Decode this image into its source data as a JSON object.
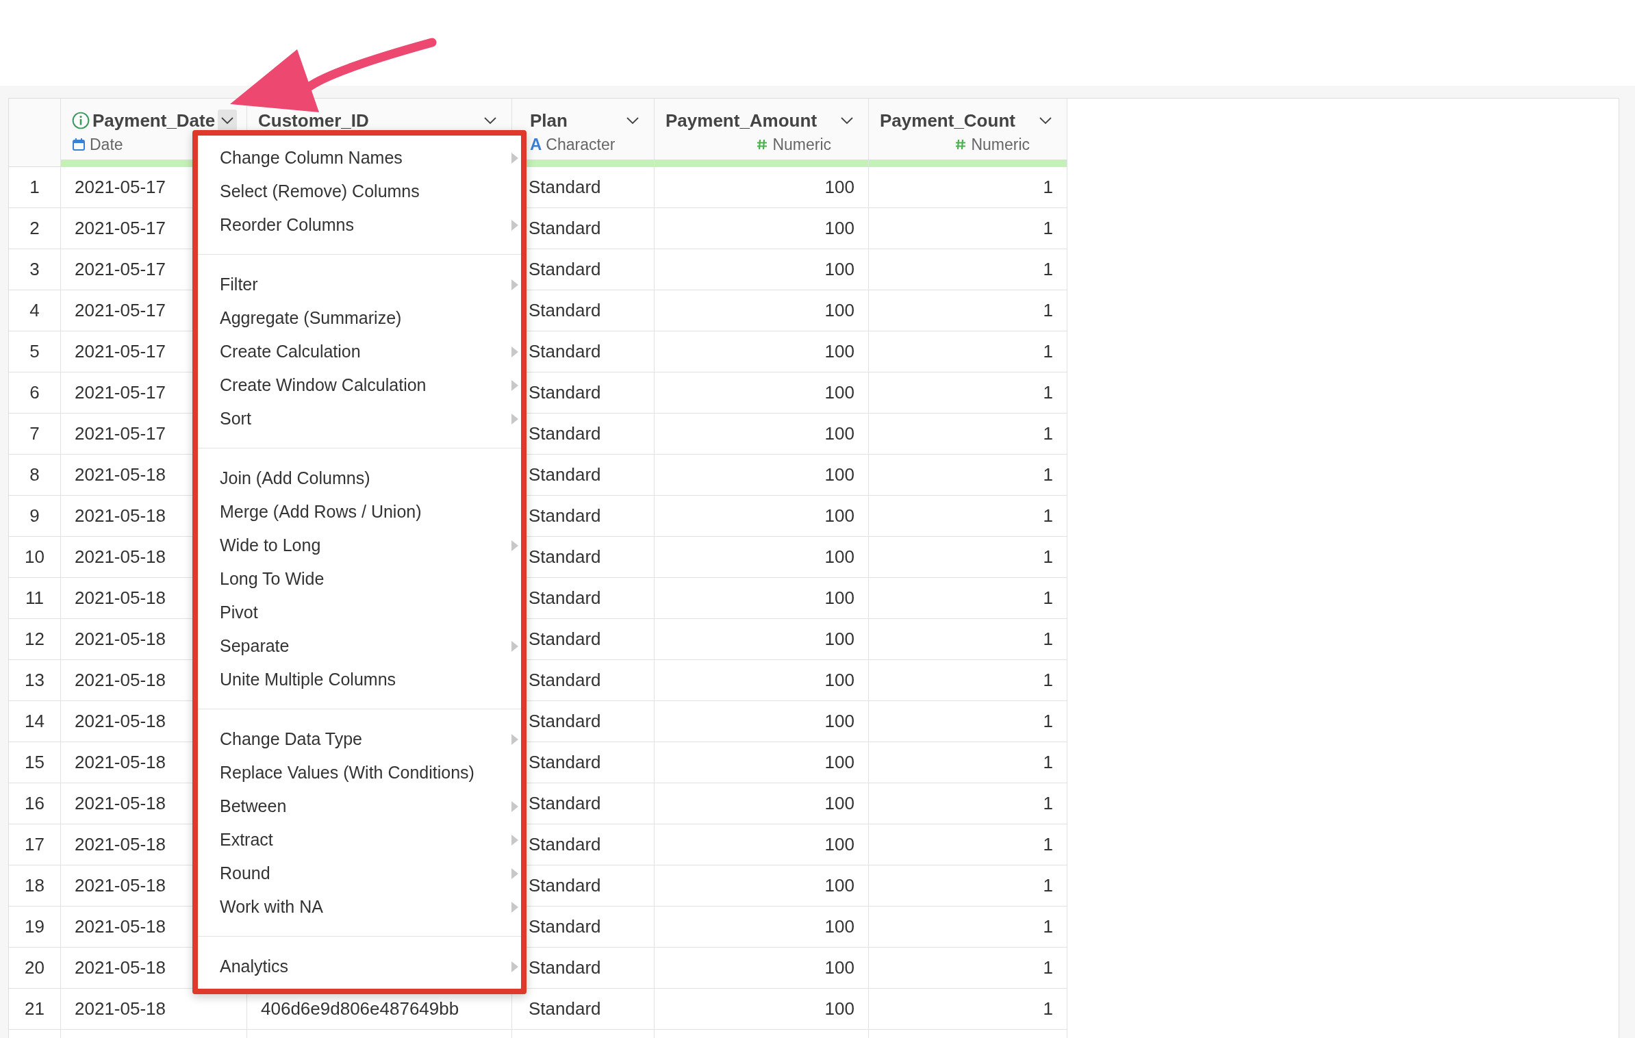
{
  "columns": [
    {
      "name": "Payment_Date",
      "type": "Date",
      "kind": "date",
      "info": true,
      "selected": true
    },
    {
      "name": "Customer_ID",
      "info": false,
      "selected": false
    },
    {
      "name": "Plan",
      "type": "Character",
      "kind": "character",
      "type_glyph": "A",
      "info": false,
      "selected": false
    },
    {
      "name": "Payment_Amount",
      "type": "Numeric",
      "kind": "numeric",
      "info": false,
      "selected": false
    },
    {
      "name": "Payment_Count",
      "type": "Numeric",
      "kind": "numeric",
      "info": false,
      "selected": false
    }
  ],
  "rows": [
    {
      "num": "1",
      "date": "2021-05-17",
      "plan": "Standard",
      "amount": "100",
      "count": "1"
    },
    {
      "num": "2",
      "date": "2021-05-17",
      "plan": "Standard",
      "amount": "100",
      "count": "1"
    },
    {
      "num": "3",
      "date": "2021-05-17",
      "plan": "Standard",
      "amount": "100",
      "count": "1"
    },
    {
      "num": "4",
      "date": "2021-05-17",
      "plan": "Standard",
      "amount": "100",
      "count": "1"
    },
    {
      "num": "5",
      "date": "2021-05-17",
      "plan": "Standard",
      "amount": "100",
      "count": "1"
    },
    {
      "num": "6",
      "date": "2021-05-17",
      "plan": "Standard",
      "amount": "100",
      "count": "1"
    },
    {
      "num": "7",
      "date": "2021-05-17",
      "plan": "Standard",
      "amount": "100",
      "count": "1"
    },
    {
      "num": "8",
      "date": "2021-05-18",
      "plan": "Standard",
      "amount": "100",
      "count": "1"
    },
    {
      "num": "9",
      "date": "2021-05-18",
      "plan": "Standard",
      "amount": "100",
      "count": "1"
    },
    {
      "num": "10",
      "date": "2021-05-18",
      "plan": "Standard",
      "amount": "100",
      "count": "1"
    },
    {
      "num": "11",
      "date": "2021-05-18",
      "plan": "Standard",
      "amount": "100",
      "count": "1"
    },
    {
      "num": "12",
      "date": "2021-05-18",
      "plan": "Standard",
      "amount": "100",
      "count": "1"
    },
    {
      "num": "13",
      "date": "2021-05-18",
      "plan": "Standard",
      "amount": "100",
      "count": "1"
    },
    {
      "num": "14",
      "date": "2021-05-18",
      "plan": "Standard",
      "amount": "100",
      "count": "1"
    },
    {
      "num": "15",
      "date": "2021-05-18",
      "plan": "Standard",
      "amount": "100",
      "count": "1"
    },
    {
      "num": "16",
      "date": "2021-05-18",
      "plan": "Standard",
      "amount": "100",
      "count": "1"
    },
    {
      "num": "17",
      "date": "2021-05-18",
      "plan": "Standard",
      "amount": "100",
      "count": "1"
    },
    {
      "num": "18",
      "date": "2021-05-18",
      "plan": "Standard",
      "amount": "100",
      "count": "1"
    },
    {
      "num": "19",
      "date": "2021-05-18",
      "plan": "Standard",
      "amount": "100",
      "count": "1"
    },
    {
      "num": "20",
      "date": "2021-05-18",
      "plan": "Standard",
      "amount": "100",
      "count": "1"
    },
    {
      "num": "21",
      "date": "2021-05-18",
      "customer_id": "406d6e9d806e487649bb",
      "plan": "Standard",
      "amount": "100",
      "count": "1"
    }
  ],
  "context_menu": {
    "groups": [
      {
        "items": [
          {
            "label": "Change Column Names",
            "submenu": true
          },
          {
            "label": "Select (Remove) Columns",
            "submenu": false
          },
          {
            "label": "Reorder Columns",
            "submenu": true
          }
        ]
      },
      {
        "items": [
          {
            "label": "Filter",
            "submenu": true
          },
          {
            "label": "Aggregate (Summarize)",
            "submenu": false
          },
          {
            "label": "Create Calculation",
            "submenu": true
          },
          {
            "label": "Create Window Calculation",
            "submenu": true
          },
          {
            "label": "Sort",
            "submenu": true
          }
        ]
      },
      {
        "items": [
          {
            "label": "Join (Add Columns)",
            "submenu": false
          },
          {
            "label": "Merge (Add Rows / Union)",
            "submenu": false
          },
          {
            "label": "Wide to Long",
            "submenu": true
          },
          {
            "label": "Long To Wide",
            "submenu": false
          },
          {
            "label": "Pivot",
            "submenu": false
          },
          {
            "label": "Separate",
            "submenu": true
          },
          {
            "label": "Unite Multiple Columns",
            "submenu": false
          }
        ]
      },
      {
        "items": [
          {
            "label": "Change Data Type",
            "submenu": true
          },
          {
            "label": "Replace Values (With Conditions)",
            "submenu": false
          },
          {
            "label": "Between",
            "submenu": true
          },
          {
            "label": "Extract",
            "submenu": true
          },
          {
            "label": "Round",
            "submenu": true
          },
          {
            "label": "Work with NA",
            "submenu": true
          }
        ]
      },
      {
        "items": [
          {
            "label": "Analytics",
            "submenu": true
          }
        ]
      }
    ]
  }
}
